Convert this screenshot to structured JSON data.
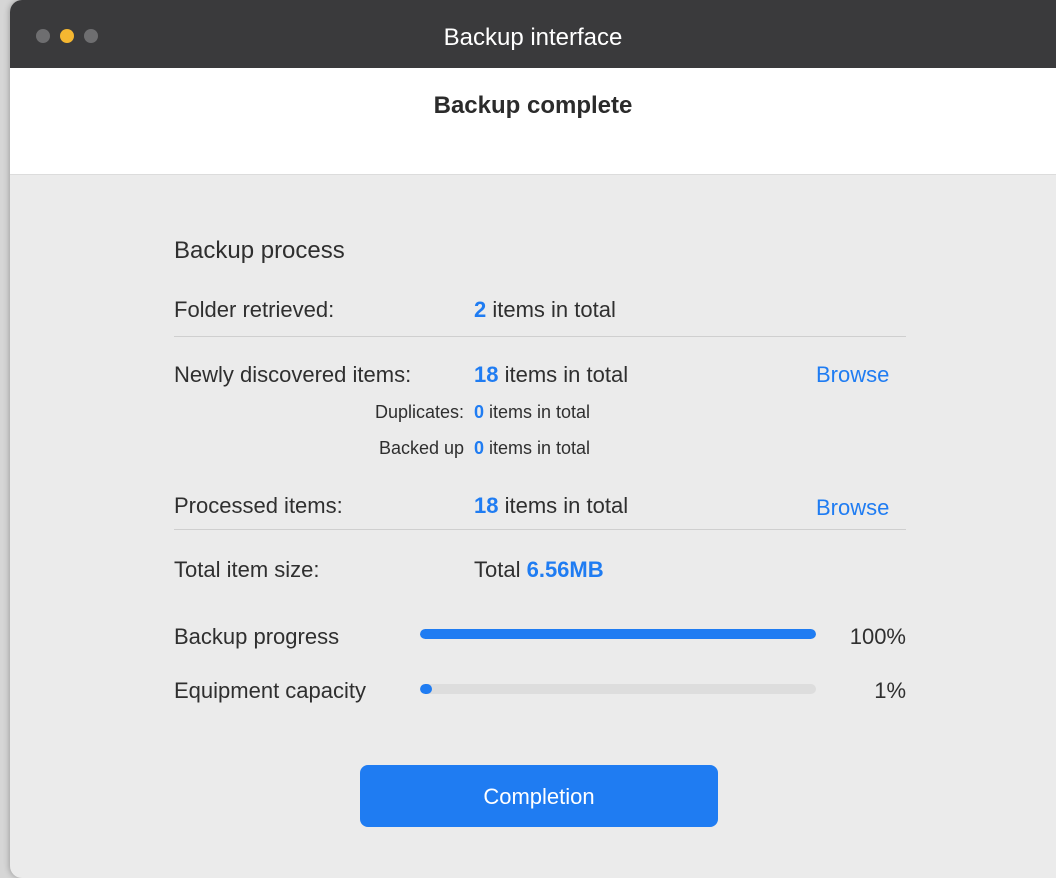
{
  "window": {
    "title": "Backup interface"
  },
  "header": {
    "title": "Backup complete"
  },
  "process": {
    "section_title": "Backup process",
    "folder_retrieved": {
      "label": "Folder retrieved:",
      "count": "2",
      "suffix": " items in total"
    },
    "newly_discovered": {
      "label": "Newly discovered items:",
      "count": "18",
      "suffix": " items in total",
      "browse_label": "Browse"
    },
    "duplicates": {
      "label": "Duplicates:",
      "count": "0",
      "suffix": " items in total"
    },
    "backed_up": {
      "label": "Backed up",
      "count": "0",
      "suffix": " items in total"
    },
    "processed": {
      "label": "Processed items:",
      "count": "18",
      "suffix": " items in total",
      "browse_label": "Browse"
    },
    "total_size": {
      "label": "Total item size:",
      "prefix": "Total ",
      "value": "6.56MB"
    },
    "backup_progress": {
      "label": "Backup progress",
      "percent_text": "100%",
      "fraction": 1.0
    },
    "equipment_capacity": {
      "label": "Equipment capacity",
      "percent_text": "1%",
      "fraction": 0.01
    }
  },
  "actions": {
    "completion_label": "Completion"
  },
  "colors": {
    "accent": "#1f7cf2",
    "titlebar": "#3a3a3c",
    "minimize": "#f5b731"
  }
}
